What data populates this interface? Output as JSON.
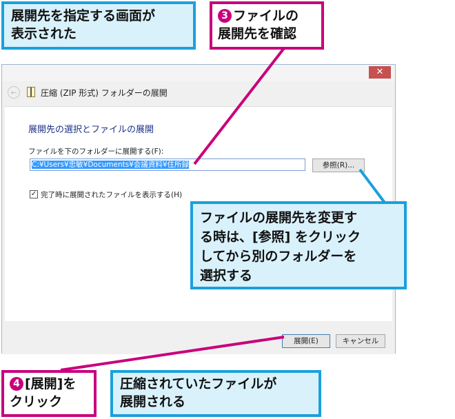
{
  "window": {
    "close_glyph": "✕",
    "back_glyph": "←",
    "wizard_title": "圧縮 (ZIP 形式) フォルダーの展開",
    "heading": "展開先の選択とファイルの展開",
    "field_label": "ファイルを下のフォルダーに展開する(F):",
    "path_value": "C:¥Users¥忠敏¥Documents¥会議資料¥住所録",
    "browse_label": "参照(R)...",
    "checkbox_mark": "✓",
    "checkbox_label": "完了時に展開されたファイルを表示する(H)",
    "extract_label": "展開(E)",
    "cancel_label": "キャンセル"
  },
  "callouts": {
    "screen_shown": [
      "展開先を指定する画面が",
      "表示された"
    ],
    "step3_number": "3",
    "step3": [
      "ファイルの",
      "展開先を確認"
    ],
    "change_tip": [
      "ファイルの展開先を変更す",
      "る時は、[参照] をクリック",
      "してから別のフォルダーを",
      "選択する"
    ],
    "step4_number": "4",
    "step4": [
      "[展開]を",
      "クリック"
    ],
    "result": [
      "圧縮されていたファイルが",
      "展開される"
    ]
  },
  "colors": {
    "callout_blue": "#1aa0dc",
    "callout_pink": "#c8007c",
    "callout_fill": "#d9f1fb",
    "heading_blue": "#1e3287",
    "selection": "#3399ff"
  },
  "icons": [
    "close-icon",
    "back-arrow-icon",
    "zip-folder-icon",
    "checkmark-icon"
  ]
}
